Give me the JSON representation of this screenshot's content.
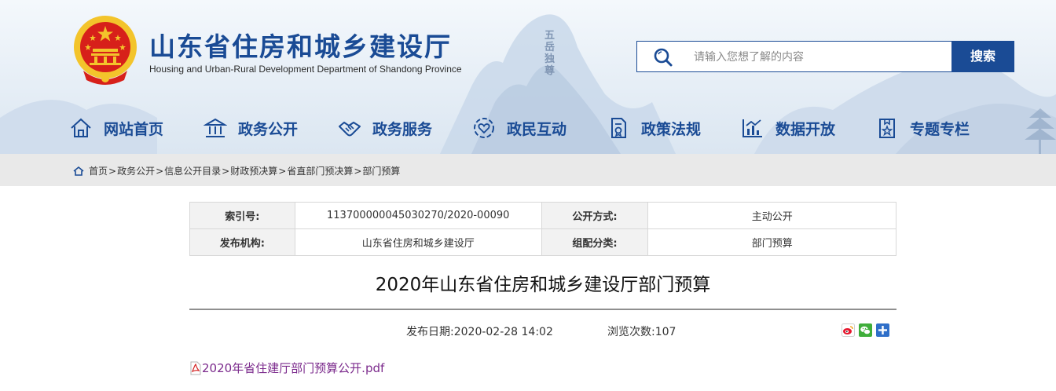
{
  "header": {
    "title": "山东省住房和城乡建设厅",
    "subtitle": "Housing and Urban-Rural Development Department of Shandong Province",
    "mountain_inscription": "五岳独尊",
    "search": {
      "placeholder": "请输入您想了解的内容",
      "button_label": "搜索"
    },
    "colors": {
      "brand": "#1a4b95",
      "emblem_red": "#d7201a",
      "emblem_gold": "#f3c42b"
    }
  },
  "nav": {
    "items": [
      {
        "label": "网站首页",
        "icon": "home-icon"
      },
      {
        "label": "政务公开",
        "icon": "government-building-icon"
      },
      {
        "label": "政务服务",
        "icon": "handshake-icon"
      },
      {
        "label": "政民互动",
        "icon": "heart-people-icon"
      },
      {
        "label": "政策法规",
        "icon": "document-seal-icon"
      },
      {
        "label": "数据开放",
        "icon": "bar-chart-icon"
      },
      {
        "label": "专题专栏",
        "icon": "bookmark-star-icon"
      }
    ]
  },
  "breadcrumb": {
    "icon": "home-icon",
    "items": [
      "首页",
      "政务公开",
      "信息公开目录",
      "财政预决算",
      "省直部门预决算",
      "部门预算"
    ],
    "separator": ">"
  },
  "meta": {
    "index_label": "索引号:",
    "index_value": "113700000045030270/2020-00090",
    "open_mode_label": "公开方式:",
    "open_mode_value": "主动公开",
    "issuer_label": "发布机构:",
    "issuer_value": "山东省住房和城乡建设厅",
    "category_label": "组配分类:",
    "category_value": "部门预算"
  },
  "article": {
    "title": "2020年山东省住房和城乡建设厅部门预算",
    "publish_date": "发布日期:2020-02-28 14:02",
    "views": "浏览次数:107",
    "share_icons": [
      "weibo-icon",
      "wechat-icon",
      "plus-share-icon"
    ],
    "attachment": {
      "label": "2020年省住建厅部门预算公开.pdf",
      "icon": "pdf-icon",
      "color": "#7b2a8c"
    }
  }
}
